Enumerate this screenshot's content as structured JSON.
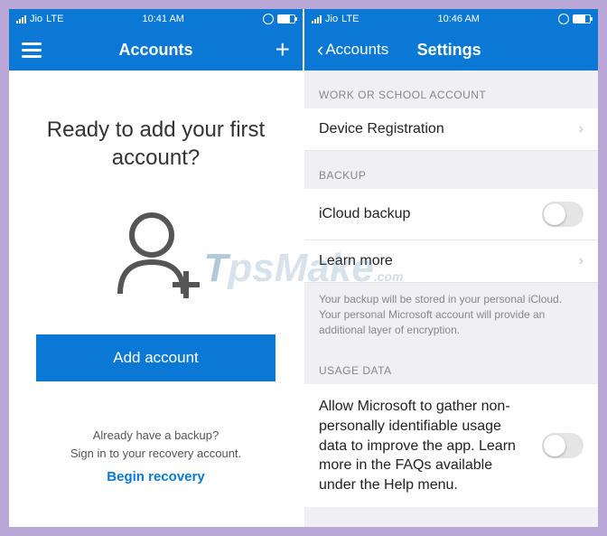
{
  "left": {
    "status": {
      "carrier": "Jio",
      "net": "LTE",
      "time": "10:41 AM"
    },
    "nav": {
      "title": "Accounts"
    },
    "hero": "Ready to add your first account?",
    "primary_btn": "Add account",
    "footer1": "Already have a backup?",
    "footer2": "Sign in to your recovery account.",
    "recovery_link": "Begin recovery"
  },
  "right": {
    "status": {
      "carrier": "Jio",
      "net": "LTE",
      "time": "10:46 AM"
    },
    "nav": {
      "back": "Accounts",
      "title": "Settings"
    },
    "sections": {
      "work": {
        "header": "WORK OR SCHOOL ACCOUNT",
        "row1": "Device Registration"
      },
      "backup": {
        "header": "BACKUP",
        "row1": "iCloud backup",
        "row2": "Learn more",
        "note": "Your backup will be stored in your personal iCloud. Your personal Microsoft account will provide an additional layer of encryption."
      },
      "usage": {
        "header": "USAGE DATA",
        "text": "Allow Microsoft to gather non-personally identifiable usage data to improve the app. Learn more in the FAQs available under the Help menu."
      }
    }
  }
}
